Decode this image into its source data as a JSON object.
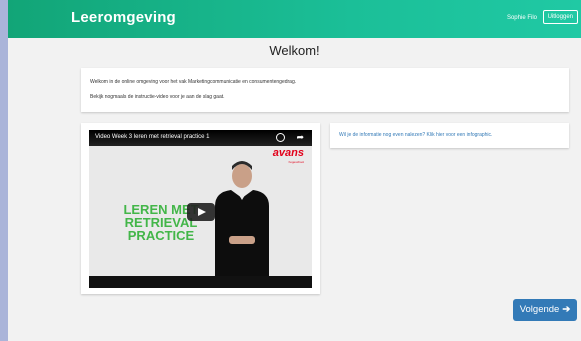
{
  "header": {
    "app_title": "Leeromgeving",
    "user_name": "Sophie Filo",
    "logout_label": "Uitloggen",
    "colors": {
      "gradient_start": "#12a577",
      "gradient_end": "#20c9a4"
    }
  },
  "main": {
    "title": "Welkom!",
    "intro": {
      "line1": "Welkom in de online omgeving voor het vak Marketingcommunicatie en consumentengedrag.",
      "line2": "Bekijk nogmaals de instructie-video voor je aan de slag gaat."
    },
    "video": {
      "title": "Video Week 3 leren met retrieval practice 1",
      "brand": "avans",
      "brand_sub": "hogeschool",
      "overlay_lines": [
        "LEREN MET",
        "RETRIEVAL",
        "PRACTICE"
      ],
      "icons": [
        "watch-later-icon",
        "share-icon",
        "play-icon"
      ]
    },
    "info_link": "Wil je de informatie nog even nalezen? Klik hier voor een infographic."
  },
  "footer": {
    "next_label": "Volgende",
    "next_icon": "arrow-right-icon",
    "accent": "#337ab7"
  }
}
